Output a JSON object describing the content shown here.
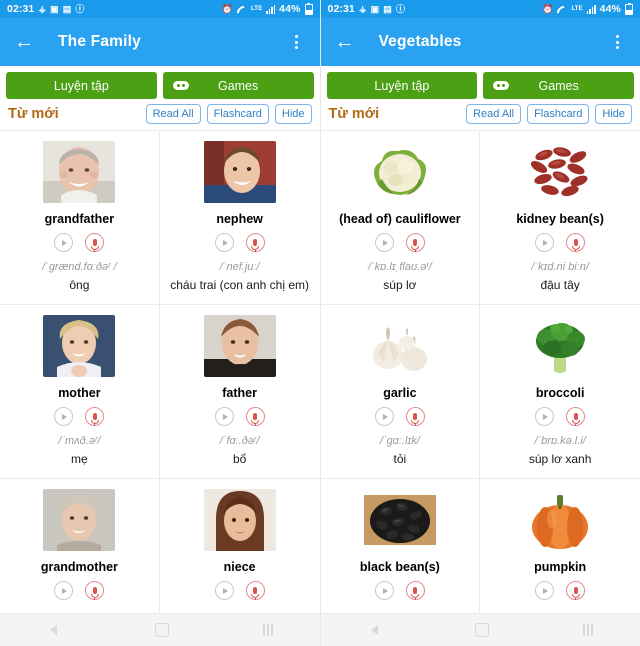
{
  "status_bar": {
    "time": "02:31",
    "battery": "44%",
    "network": "LTE",
    "left_icons": [
      "contact-sync-icon",
      "photo-icon",
      "copy-icon",
      "volume-icon"
    ],
    "right_icons": [
      "alarm-icon",
      "wifi-icon",
      "lte-icon",
      "signal-icon",
      "battery-icon"
    ]
  },
  "colors": {
    "status_bar": "#1a9aeb",
    "app_bar": "#29a2f2",
    "green_button": "#4ca013",
    "section_title": "#b06a15",
    "chip_border": "#7cb6e8",
    "chip_text": "#2f7fc4",
    "mic_red": "#d9534f"
  },
  "nav_bar": {
    "back_label": "back",
    "home_label": "home",
    "recents_label": "recents"
  },
  "screens": [
    {
      "app_bar": {
        "back_icon": "back-arrow-icon",
        "title": "The Family",
        "overflow_icon": "kebab-menu-icon"
      },
      "actions": {
        "practice_label": "Luyện tập",
        "games_label": "Games",
        "games_icon": "gamepad-icon"
      },
      "section": {
        "title": "Từ mới",
        "chips": [
          "Read All",
          "Flashcard",
          "Hide"
        ]
      },
      "words": [
        {
          "word": "grandfather",
          "ipa": "/ˈgrænd.fɑːðəʳ /",
          "vi": "ông",
          "image": "photo-elderly-man",
          "play_icon": "play-icon",
          "mic_icon": "microphone-icon"
        },
        {
          "word": "nephew",
          "ipa": "/ˈnef.juː/",
          "vi": "cháu trai (con anh chị em)",
          "image": "photo-boy",
          "play_icon": "play-icon",
          "mic_icon": "microphone-icon"
        },
        {
          "word": "mother",
          "ipa": "/ˈmʌð.əʳ/",
          "vi": "mẹ",
          "image": "photo-woman",
          "play_icon": "play-icon",
          "mic_icon": "microphone-icon"
        },
        {
          "word": "father",
          "ipa": "/ˈfɑː.ðəʳ/",
          "vi": "bố",
          "image": "photo-man",
          "play_icon": "play-icon",
          "mic_icon": "microphone-icon"
        },
        {
          "word": "grandmother",
          "ipa": "",
          "vi": "",
          "image": "photo-elderly-woman",
          "play_icon": "play-icon",
          "mic_icon": "microphone-icon"
        },
        {
          "word": "niece",
          "ipa": "",
          "vi": "",
          "image": "photo-girl",
          "play_icon": "play-icon",
          "mic_icon": "microphone-icon"
        }
      ]
    },
    {
      "app_bar": {
        "back_icon": "back-arrow-icon",
        "title": "Vegetables",
        "overflow_icon": "kebab-menu-icon"
      },
      "actions": {
        "practice_label": "Luyện tập",
        "games_label": "Games",
        "games_icon": "gamepad-icon"
      },
      "section": {
        "title": "Từ mới",
        "chips": [
          "Read All",
          "Flashcard",
          "Hide"
        ]
      },
      "words": [
        {
          "word": "(head of) cauliflower",
          "ipa": "/ˈkɒ.lɪˌflaʊ.əʳ/",
          "vi": "súp lơ",
          "image": "photo-cauliflower",
          "play_icon": "play-icon",
          "mic_icon": "microphone-icon"
        },
        {
          "word": "kidney bean(s)",
          "ipa": "/ˈkɪd.ni biːn/",
          "vi": "đậu tây",
          "image": "photo-kidney-beans",
          "play_icon": "play-icon",
          "mic_icon": "microphone-icon"
        },
        {
          "word": "garlic",
          "ipa": "/ˈgɑː.lɪk/",
          "vi": "tỏi",
          "image": "photo-garlic",
          "play_icon": "play-icon",
          "mic_icon": "microphone-icon"
        },
        {
          "word": "broccoli",
          "ipa": "/ˈbrɒ.kə.l.i/",
          "vi": "súp lơ xanh",
          "image": "photo-broccoli",
          "play_icon": "play-icon",
          "mic_icon": "microphone-icon"
        },
        {
          "word": "black bean(s)",
          "ipa": "",
          "vi": "",
          "image": "photo-black-beans",
          "play_icon": "play-icon",
          "mic_icon": "microphone-icon"
        },
        {
          "word": "pumpkin",
          "ipa": "",
          "vi": "",
          "image": "photo-pumpkin",
          "play_icon": "play-icon",
          "mic_icon": "microphone-icon"
        }
      ]
    }
  ]
}
